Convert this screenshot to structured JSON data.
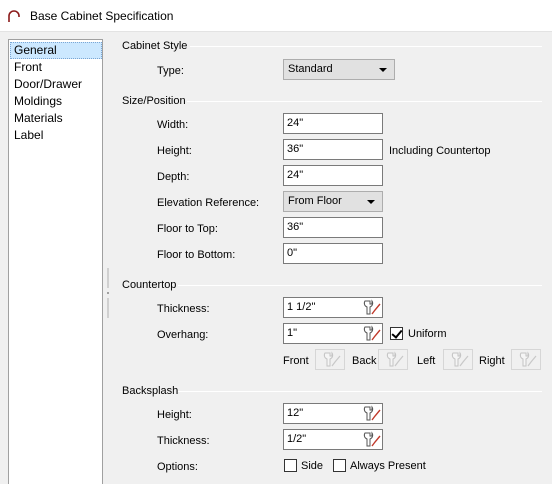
{
  "window": {
    "title": "Base Cabinet Specification"
  },
  "nav": {
    "items": [
      {
        "label": "General",
        "selected": true
      },
      {
        "label": "Front"
      },
      {
        "label": "Door/Drawer"
      },
      {
        "label": "Moldings"
      },
      {
        "label": "Materials"
      },
      {
        "label": "Label"
      }
    ]
  },
  "cabinet_style": {
    "title": "Cabinet Style",
    "type_label": "Type:",
    "type_value": "Standard"
  },
  "size_position": {
    "title": "Size/Position",
    "width_label": "Width:",
    "width_value": "24\"",
    "height_label": "Height:",
    "height_value": "36\"",
    "height_note": "Including Countertop",
    "depth_label": "Depth:",
    "depth_value": "24\"",
    "elev_label": "Elevation Reference:",
    "elev_value": "From Floor",
    "floor_top_label": "Floor to Top:",
    "floor_top_value": "36\"",
    "floor_bottom_label": "Floor to Bottom:",
    "floor_bottom_value": "0\""
  },
  "countertop": {
    "title": "Countertop",
    "thickness_label": "Thickness:",
    "thickness_value": "1 1/2\"",
    "overhang_label": "Overhang:",
    "overhang_value": "1\"",
    "uniform_label": "Uniform",
    "uniform_checked": true,
    "front_label": "Front",
    "back_label": "Back",
    "left_label": "Left",
    "right_label": "Right"
  },
  "backsplash": {
    "title": "Backsplash",
    "height_label": "Height:",
    "height_value": "12\"",
    "thickness_label": "Thickness:",
    "thickness_value": "1/2\"",
    "options_label": "Options:",
    "side_label": "Side",
    "side_checked": false,
    "always_label": "Always Present",
    "always_checked": false
  }
}
